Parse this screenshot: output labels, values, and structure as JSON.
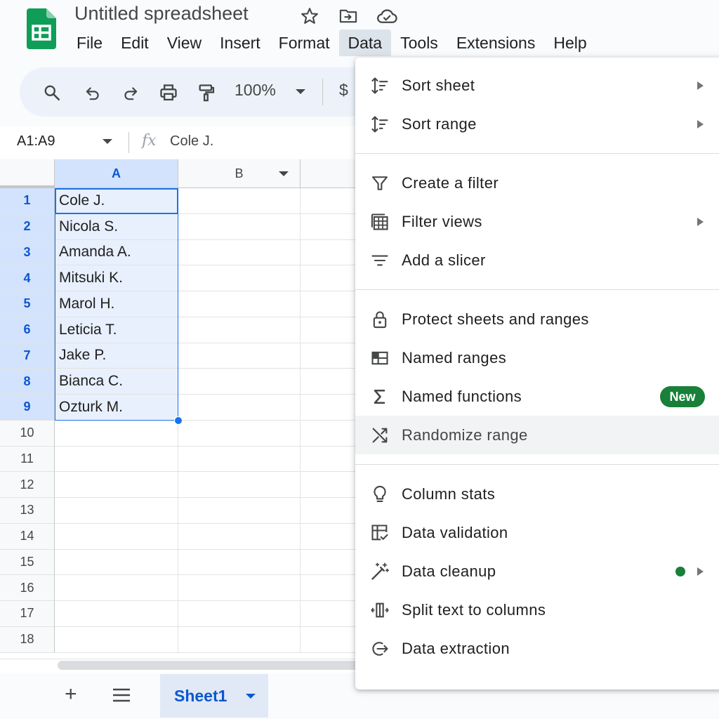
{
  "app": {
    "title": "Untitled spreadsheet",
    "menu": [
      "File",
      "Edit",
      "View",
      "Insert",
      "Format",
      "Data",
      "Tools",
      "Extensions",
      "Help"
    ],
    "active_menu": "Data"
  },
  "toolbar": {
    "zoom": "100%",
    "currency_symbol": "$"
  },
  "formula_bar": {
    "name_box": "A1:A9",
    "fx_symbol": "fx",
    "value": "Cole J."
  },
  "grid": {
    "columns": [
      "A",
      "B"
    ],
    "row_numbers": [
      "1",
      "2",
      "3",
      "4",
      "5",
      "6",
      "7",
      "8",
      "9",
      "10",
      "11",
      "12",
      "13",
      "14",
      "15",
      "16",
      "17",
      "18"
    ],
    "column_a_values": [
      "Cole J.",
      "Nicola S.",
      "Amanda A.",
      "Mitsuki K.",
      "Marol H.",
      "Leticia T.",
      "Jake P.",
      "Bianca C.",
      "Ozturk M."
    ],
    "selected_range": "A1:A9",
    "active_cell": "A1"
  },
  "bottom_bar": {
    "add_symbol": "+",
    "sheet_tab": "Sheet1"
  },
  "data_menu": {
    "items": [
      {
        "label": "Sort sheet",
        "icon": "sort-icon",
        "submenu": true
      },
      {
        "label": "Sort range",
        "icon": "sort-icon",
        "submenu": true
      },
      {
        "label": "Create a filter",
        "icon": "filter-icon",
        "submenu": false
      },
      {
        "label": "Filter views",
        "icon": "filter-views-icon",
        "submenu": true
      },
      {
        "label": "Add a slicer",
        "icon": "slicer-icon",
        "submenu": false
      },
      {
        "label": "Protect sheets and ranges",
        "icon": "lock-icon",
        "submenu": false
      },
      {
        "label": "Named ranges",
        "icon": "named-ranges-icon",
        "submenu": false
      },
      {
        "label": "Named functions",
        "icon": "sigma-icon",
        "badge": "New"
      },
      {
        "label": "Randomize range",
        "icon": "shuffle-icon",
        "hovered": true
      },
      {
        "label": "Column stats",
        "icon": "lightbulb-icon",
        "submenu": false
      },
      {
        "label": "Data validation",
        "icon": "data-validation-icon",
        "submenu": false
      },
      {
        "label": "Data cleanup",
        "icon": "magic-wand-icon",
        "submenu": true,
        "dot": true
      },
      {
        "label": "Split text to columns",
        "icon": "split-columns-icon",
        "submenu": false
      },
      {
        "label": "Data extraction",
        "icon": "data-extraction-icon",
        "submenu": false
      }
    ]
  },
  "colors": {
    "brand_green": "#0f9d58",
    "selection_blue": "#1a73e8",
    "badge_green": "#188038"
  }
}
